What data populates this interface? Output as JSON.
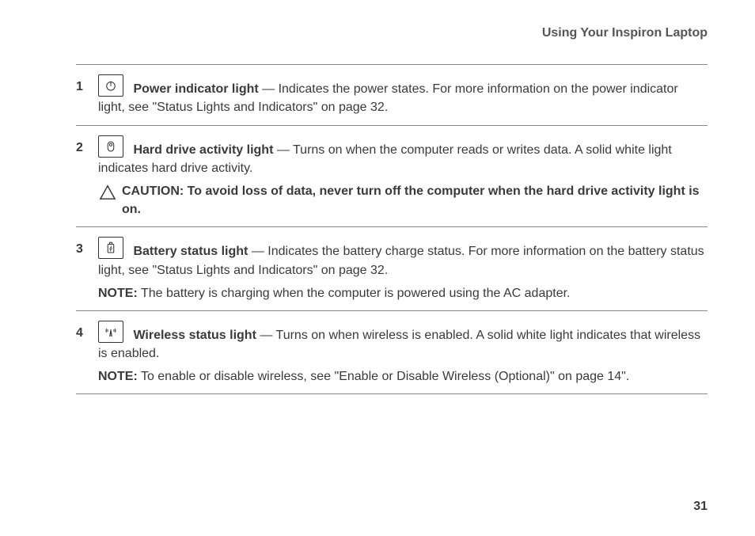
{
  "header": "Using Your Inspiron Laptop",
  "page_number": "31",
  "items": [
    {
      "num": "1",
      "icon_name": "power-icon",
      "term": "Power indicator light",
      "desc": " — Indicates the power states. For more information on the power indicator light, see \"Status Lights and Indicators\" on page 32."
    },
    {
      "num": "2",
      "icon_name": "hard-drive-icon",
      "term": "Hard drive activity light",
      "desc": " — Turns on when the computer reads or writes data. A solid white light indicates hard drive activity.",
      "caution": "CAUTION: To avoid loss of data, never turn off the computer when the hard drive activity light is on."
    },
    {
      "num": "3",
      "icon_name": "battery-icon",
      "term": "Battery status light",
      "desc": " — Indicates the battery charge status. For more information on the battery status light, see \"Status Lights and Indicators\" on page 32.",
      "note_label": "NOTE:",
      "note": " The battery is charging when the computer is powered using the AC adapter."
    },
    {
      "num": "4",
      "icon_name": "wireless-icon",
      "term": "Wireless status light",
      "desc": " — Turns on when wireless is enabled. A solid white light indicates that wireless is enabled.",
      "note_label": "NOTE:",
      "note": " To enable or disable wireless, see \"Enable or Disable Wireless (Optional)\" on page 14\"."
    }
  ]
}
